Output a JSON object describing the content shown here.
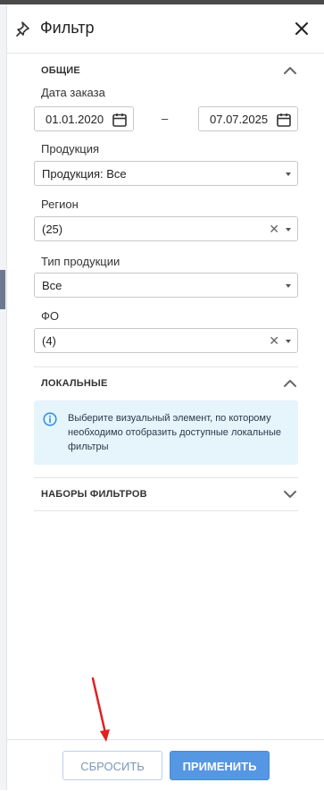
{
  "panel": {
    "title": "Фильтр"
  },
  "sections": {
    "general": {
      "label": "ОБЩИЕ",
      "order_date": {
        "label": "Дата заказа",
        "from": "01.01.2020",
        "separator": "–",
        "to": "07.07.2025"
      },
      "products": {
        "label": "Продукция",
        "value": "Продукция: Все"
      },
      "region": {
        "label": "Регион",
        "value": "(25)"
      },
      "product_type": {
        "label": "Тип продукции",
        "value": "Все"
      },
      "fo": {
        "label": "ФО",
        "value": "(4)"
      }
    },
    "local": {
      "label": "ЛОКАЛЬНЫЕ",
      "info_text": "Выберите визуальный элемент, по которому необходимо отобразить доступные локальные фильтры"
    },
    "filter_sets": {
      "label": "НАБОРЫ ФИЛЬТРОВ"
    }
  },
  "footer": {
    "reset_label": "СБРОСИТЬ",
    "apply_label": "ПРИМЕНИТЬ"
  },
  "icons": {
    "pin": "pin-icon",
    "close": "close-icon",
    "calendar": "calendar-icon",
    "chevron_up": "chevron-up-icon",
    "chevron_down": "chevron-down-icon",
    "info": "info-icon",
    "clear": "clear-icon",
    "caret": "caret-down-icon"
  },
  "colors": {
    "accent": "#5597e2",
    "info_bg": "#e6f4fc",
    "info_icon": "#2f8ee0",
    "annotation_arrow": "#e02020"
  }
}
